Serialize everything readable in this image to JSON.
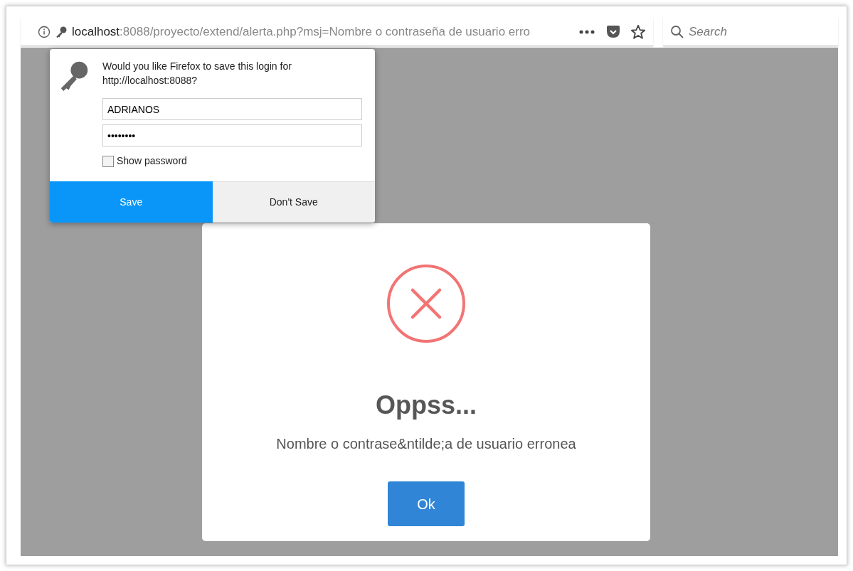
{
  "urlbar": {
    "host": "localhost",
    "rest": ":8088/proyecto/extend/alerta.php?msj=Nombre o contraseña de usuario erro"
  },
  "search": {
    "placeholder": "Search"
  },
  "login_popup": {
    "message": "Would you like Firefox to save this login for http://localhost:8088?",
    "username": "ADRIANOS",
    "password": "••••••••",
    "show_password": {
      "label": "Show password",
      "checked": false
    },
    "buttons": [
      {
        "label": "Save",
        "kind": "primary"
      },
      {
        "label": "Don't Save",
        "kind": "secondary"
      }
    ]
  },
  "alert": {
    "title": "Oppss...",
    "message": "Nombre o contrase&ntilde;a de usuario erronea",
    "button": "Ok"
  }
}
